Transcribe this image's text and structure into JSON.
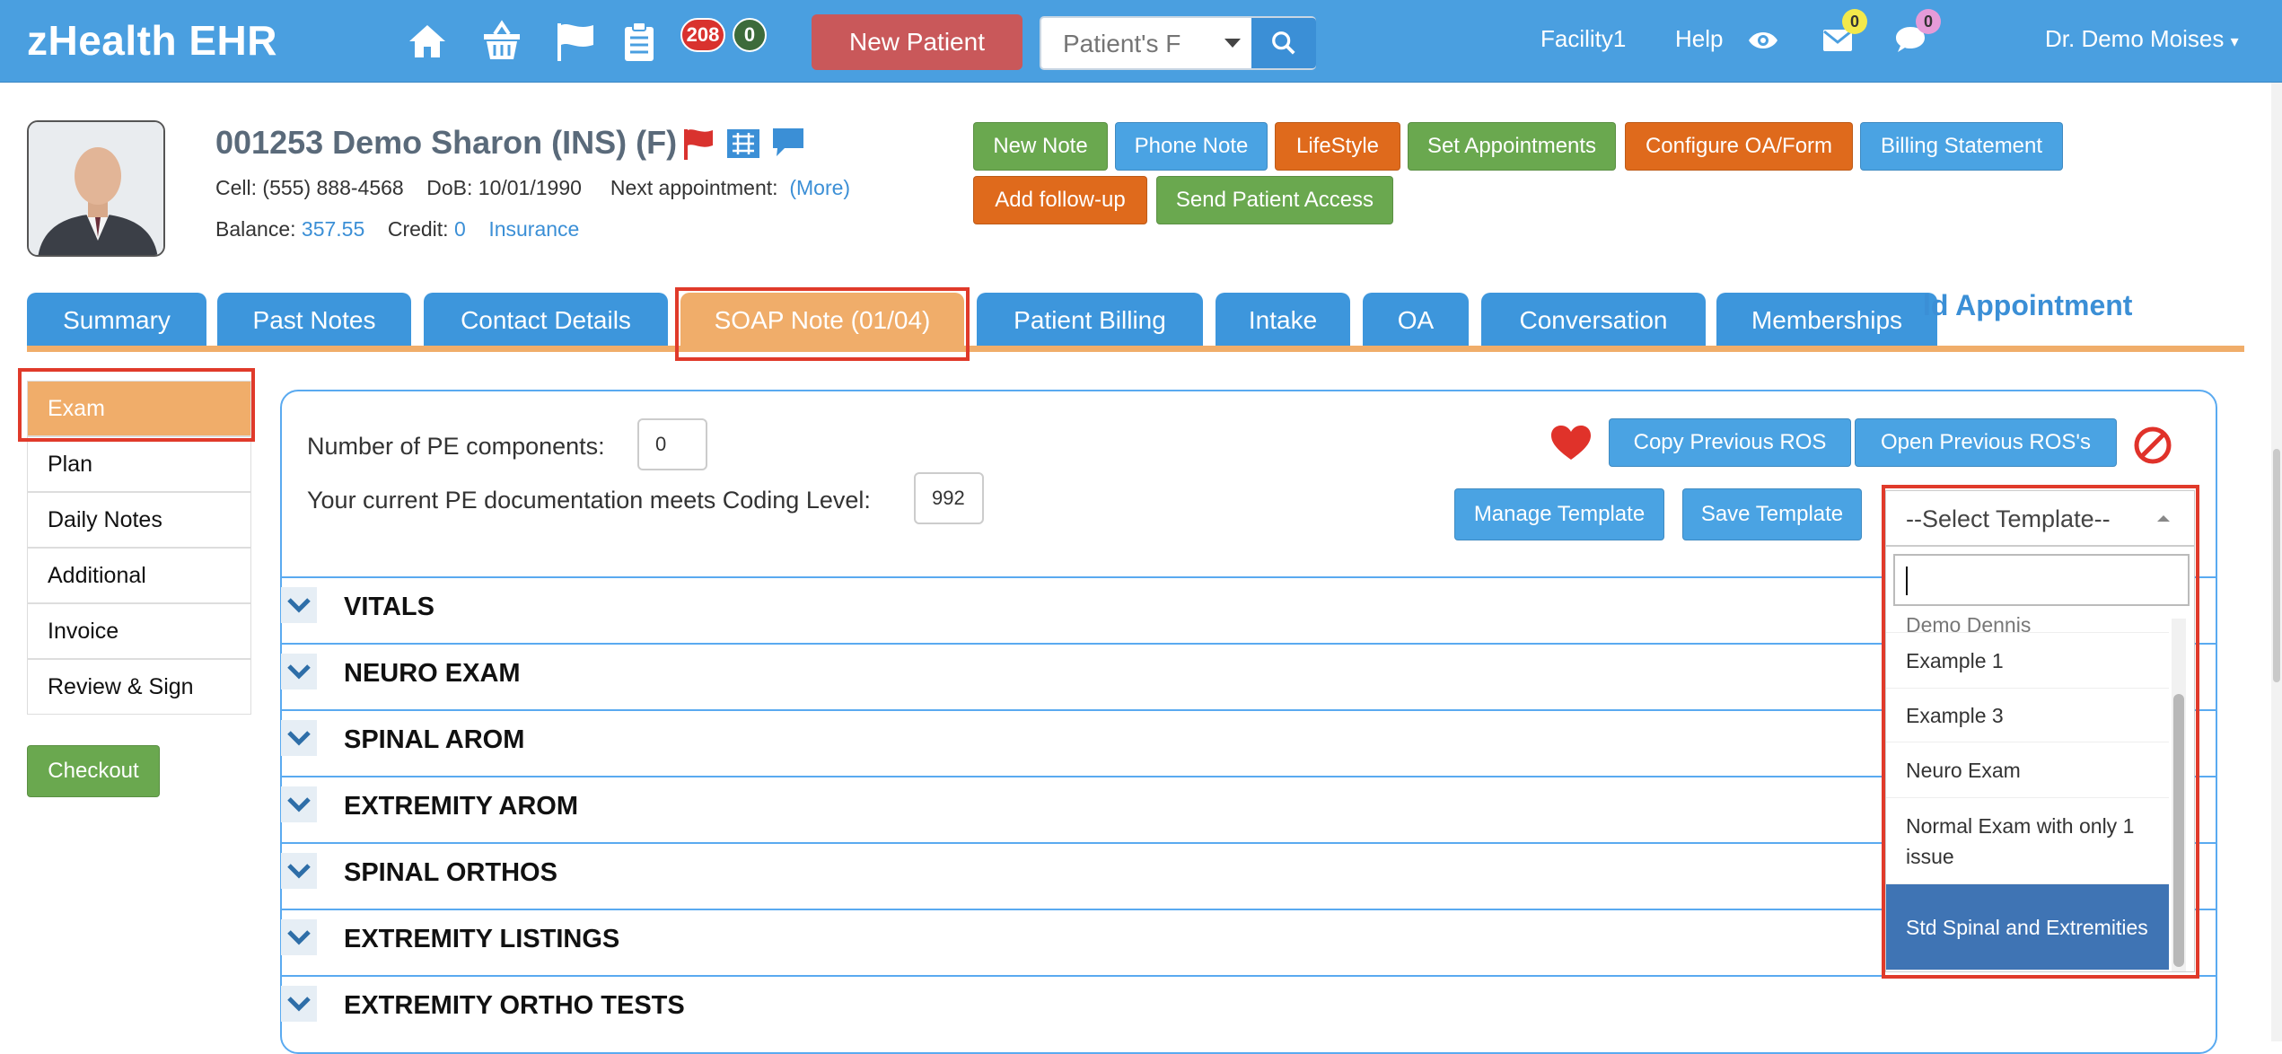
{
  "navbar": {
    "brand": "zHealth EHR",
    "icons": [
      "home-icon",
      "basket-icon",
      "flag-icon",
      "clipboard-icon"
    ],
    "badge_red": "208",
    "badge_green": "0",
    "new_patient_label": "New Patient",
    "search_placeholder": "Patient's F",
    "facility": "Facility1",
    "help": "Help",
    "mail_count": "0",
    "chat_count": "0",
    "user": "Dr. Demo Moises",
    "colors": {
      "bar": "#4a9fe0",
      "new_patient": "#c9585a"
    }
  },
  "patient": {
    "name": "001253 Demo Sharon  (INS) (F)",
    "cell_label": "Cell:",
    "cell": "(555) 888-4568",
    "dob_label": "DoB:",
    "dob": "10/01/1990",
    "next_appt_label": "Next appointment:",
    "more": "(More)",
    "balance_label": "Balance:",
    "balance": "357.55",
    "credit_label": "Credit:",
    "credit": "0",
    "insurance": "Insurance"
  },
  "actions": {
    "new_note": "New Note",
    "phone_note": "Phone Note",
    "lifestyle": "LifeStyle",
    "set_appointments": "Set Appointments",
    "configure_oa": "Configure OA/Form",
    "billing_statement": "Billing Statement",
    "add_followup": "Add follow-up",
    "send_patient_access": "Send Patient Access"
  },
  "tabs": [
    "Summary",
    "Past Notes",
    "Contact Details",
    "SOAP Note (01/04)",
    "Patient Billing",
    "Intake",
    "OA",
    "Conversation",
    "Memberships"
  ],
  "add_appointment": "ld Appointment",
  "sidebar": [
    "Exam",
    "Plan",
    "Daily Notes",
    "Additional",
    "Invoice",
    "Review & Sign"
  ],
  "checkout": "Checkout",
  "exam": {
    "pe_components_label": "Number of PE components:",
    "pe_components_value": "0",
    "coding_level_label": "Your current PE documentation meets Coding Level:",
    "coding_level_value": "992",
    "copy_prev_ros": "Copy Previous ROS",
    "open_prev_ros": "Open Previous ROS's",
    "manage_template": "Manage Template",
    "save_template": "Save Template",
    "select_template": "--Select Template--"
  },
  "sections": [
    "VITALS",
    "NEURO EXAM",
    "SPINAL AROM",
    "EXTREMITY AROM",
    "SPINAL ORTHOS",
    "EXTREMITY LISTINGS",
    "EXTREMITY ORTHO TESTS"
  ],
  "template_options": [
    "Demo Dennis",
    "Example 1",
    "Example 3",
    "Neuro Exam",
    "Normal Exam with only 1 issue",
    "Std Spinal and Extremities"
  ],
  "selected_template": "Std Spinal and Extremities"
}
